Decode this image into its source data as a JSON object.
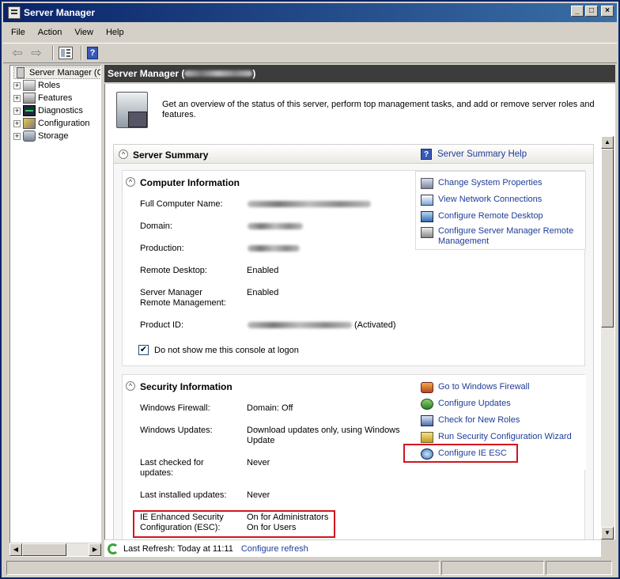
{
  "window": {
    "title": "Server Manager",
    "buttons": {
      "minimize": "_",
      "maximize": "□",
      "close": "×"
    }
  },
  "menu": [
    "File",
    "Action",
    "View",
    "Help"
  ],
  "toolbar": {
    "back_icon": "⇦",
    "forward_icon": "⇨",
    "help_icon": "?"
  },
  "tree": {
    "root": "Server Manager (C",
    "items": [
      "Roles",
      "Features",
      "Diagnostics",
      "Configuration",
      "Storage"
    ],
    "expander": "+"
  },
  "main": {
    "header_prefix": "Server Manager (",
    "header_suffix": ")",
    "overview": "Get an overview of the status of this server, perform top management tasks, and add or remove server roles and features.",
    "summary": {
      "title": "Server Summary",
      "help_link": "Server Summary Help",
      "collapse": "^"
    },
    "computer_info": {
      "title": "Computer Information",
      "rows": {
        "full_name": "Full Computer Name:",
        "domain": "Domain:",
        "production": "Production:",
        "remote_desktop": "Remote Desktop:",
        "remote_desktop_value": "Enabled",
        "smrm_line1": "Server Manager",
        "smrm_line2": "Remote Management:",
        "smrm_value": "Enabled",
        "product_id": "Product ID:",
        "product_id_suffix": "(Activated)"
      },
      "actions": [
        "Change System Properties",
        "View Network Connections",
        "Configure Remote Desktop",
        "Configure Server Manager Remote",
        "Management"
      ],
      "logon_checkbox": {
        "checked": true,
        "mark": "✔",
        "label": "Do not show me this console at logon"
      }
    },
    "security_info": {
      "title": "Security Information",
      "rows": {
        "firewall": "Windows Firewall:",
        "firewall_value": "Domain: Off",
        "updates": "Windows Updates:",
        "updates_value_1": "Download updates only, using Windows",
        "updates_value_2": "Update",
        "last_checked_1": "Last checked for",
        "last_checked_2": "updates:",
        "last_checked_value": "Never",
        "last_installed": "Last installed updates:",
        "last_installed_value": "Never",
        "esc_1": "IE Enhanced Security",
        "esc_2": "Configuration (ESC):",
        "esc_value_1": "On for Administrators",
        "esc_value_2": "On for Users"
      },
      "actions": [
        "Go to Windows Firewall",
        "Configure Updates",
        "Check for New Roles",
        "Run Security Configuration Wizard",
        "Configure IE ESC"
      ]
    },
    "refresh": {
      "text": "Last Refresh: Today at 11:11",
      "link": "Configure refresh"
    }
  },
  "scroll": {
    "up": "▲",
    "down": "▼",
    "left": "◀",
    "right": "▶"
  },
  "colors": {
    "link": "#1e3d99",
    "highlight": "#d0161e",
    "header_bg": "#3c3c3c"
  }
}
